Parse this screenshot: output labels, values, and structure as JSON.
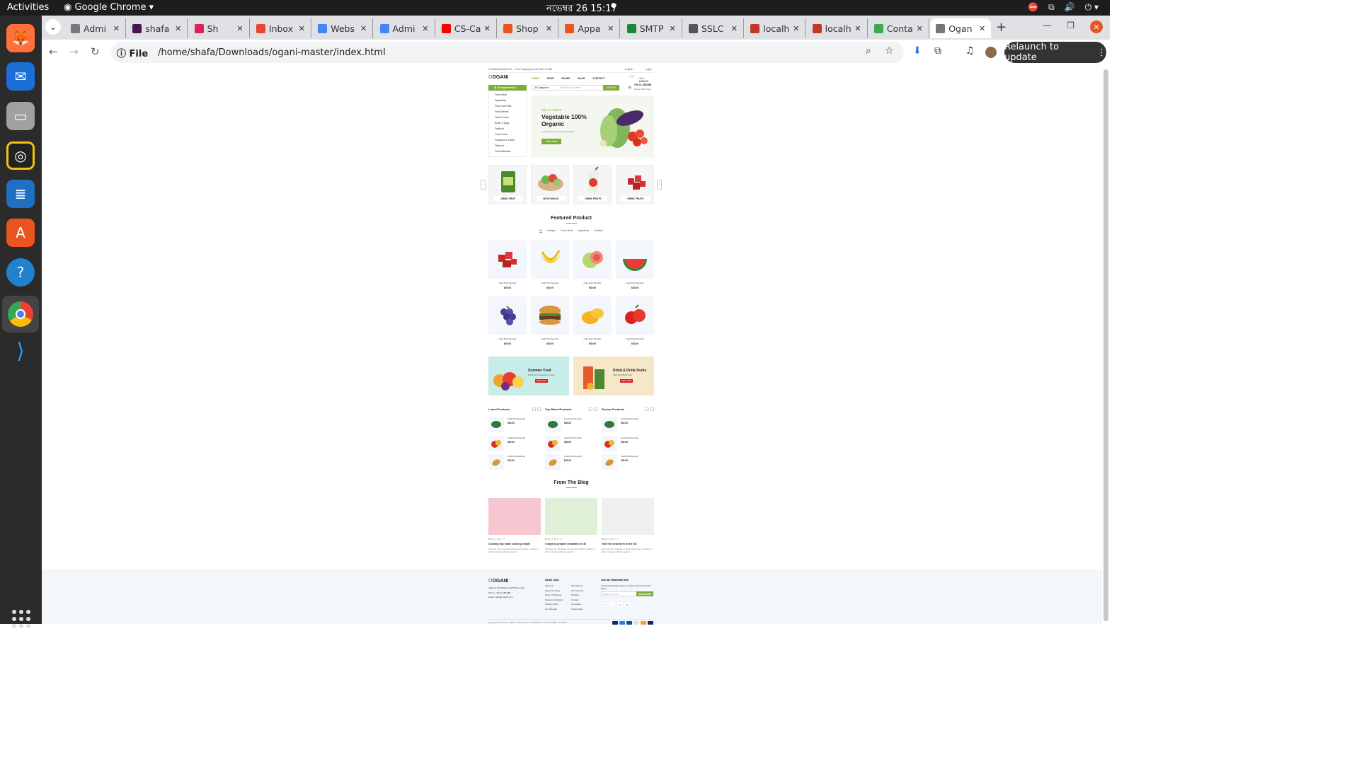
{
  "os": {
    "activities": "Activities",
    "app_menu": "Google Chrome",
    "clock": "নভেম্বর 26  15:17"
  },
  "dock": [
    "Firefox",
    "Thunderbird",
    "Files",
    "Rhythmbox",
    "LibreOffice Writer",
    "Ubuntu Software",
    "Help",
    "Google Chrome",
    "Visual Studio Code"
  ],
  "browser": {
    "tabs": [
      {
        "label": "Admi",
        "color": "#777777"
      },
      {
        "label": "shafa",
        "color": "#4a154b"
      },
      {
        "label": "Sh",
        "color": "#e01e5a"
      },
      {
        "label": "Inbox",
        "color": "#ea4335"
      },
      {
        "label": "Webs",
        "color": "#4285f4"
      },
      {
        "label": "Admi",
        "color": "#4285f4"
      },
      {
        "label": "CS-Ca",
        "color": "#ff0000"
      },
      {
        "label": "Shop",
        "color": "#e95420"
      },
      {
        "label": "Appa",
        "color": "#e95420"
      },
      {
        "label": "SMTP",
        "color": "#1a8a3a"
      },
      {
        "label": "SSLC",
        "color": "#555555"
      },
      {
        "label": "localh",
        "color": "#c0392b"
      },
      {
        "label": "localh",
        "color": "#c0392b"
      },
      {
        "label": "Conta",
        "color": "#3fa94f"
      },
      {
        "label": "Ogan",
        "color": "#777777"
      }
    ],
    "url_prefix": "File",
    "url": "/home/shafa/Downloads/ogani-master/index.html",
    "relaunch": "Relaunch to update"
  },
  "site": {
    "header_email": "hello@colorlib.com",
    "header_shipping": "Free Shipping for all Order of $99",
    "language": "English",
    "login": "Login",
    "logo": "OGANI",
    "nav": [
      "HOME",
      "SHOP",
      "PAGES",
      "BLOG",
      "CONTACT"
    ],
    "cart_item": "item:",
    "cart_total": "$150.00",
    "departments": "All departments",
    "departments_list": [
      "Fresh Meat",
      "Vegetables",
      "Fruit & Nut Gifts",
      "Fresh Berries",
      "Ocean Foods",
      "Butter & Eggs",
      "Fastfood",
      "Fresh Onion",
      "Papayaya & Crisps",
      "Oatmeal",
      "Fresh Bananas"
    ],
    "search_category": "All Categories",
    "search_placeholder": "What do you need?",
    "search_button": "SEARCH",
    "phone": "+65 11.188.888",
    "support": "support 24/7 time",
    "hero_label": "FRUIT FRESH",
    "hero_title": "Vegetable 100% Organic",
    "hero_sub": "Free Pickup and Delivery Available",
    "hero_button": "SHOP NOW",
    "categories": [
      "DRIED FRUIT",
      "VEGETABLES",
      "DRINK FRUITS",
      "DRINK FRUITS"
    ],
    "featured_title": "Featured Product",
    "filters": [
      "All",
      "Oranges",
      "Fresh Meat",
      "Vegetables",
      "Fastfood"
    ],
    "products": [
      {
        "name": "Crab Pool Security",
        "price": "$30.00",
        "icon": "meat"
      },
      {
        "name": "Crab Pool Security",
        "price": "$30.00",
        "icon": "banana"
      },
      {
        "name": "Crab Pool Security",
        "price": "$30.00",
        "icon": "guava"
      },
      {
        "name": "Crab Pool Security",
        "price": "$30.00",
        "icon": "watermelon"
      },
      {
        "name": "Crab Pool Security",
        "price": "$30.00",
        "icon": "grapes"
      },
      {
        "name": "Crab Pool Security",
        "price": "$30.00",
        "icon": "burger"
      },
      {
        "name": "Crab Pool Security",
        "price": "$30.00",
        "icon": "mango"
      },
      {
        "name": "Crab Pool Security",
        "price": "$30.00",
        "icon": "apple"
      }
    ],
    "banners": [
      {
        "title": "Summer Fruit",
        "sub": "100% Pure Natural Fruit Juice",
        "button": "SHOP NOW",
        "bg": "#c8ece8"
      },
      {
        "title": "Dried & Drink Fruits",
        "sub": "With 25% Off All Teas",
        "button": "SHOP NOW",
        "bg": "#f6e7c8"
      }
    ],
    "list_sections": [
      {
        "title": "Latest Products",
        "items": [
          {
            "name": "Crab Pool Security",
            "price": "$30.00"
          },
          {
            "name": "Crab Pool Security",
            "price": "$30.00"
          },
          {
            "name": "Crab Pool Security",
            "price": "$30.00"
          }
        ]
      },
      {
        "title": "Top Rated Products",
        "items": [
          {
            "name": "Crab Pool Security",
            "price": "$30.00"
          },
          {
            "name": "Crab Pool Security",
            "price": "$30.00"
          },
          {
            "name": "Crab Pool Security",
            "price": "$30.00"
          }
        ]
      },
      {
        "title": "Review Products",
        "items": [
          {
            "name": "Crab Pool Security",
            "price": "$30.00"
          },
          {
            "name": "Crab Pool Security",
            "price": "$30.00"
          },
          {
            "name": "Crab Pool Security",
            "price": "$30.00"
          }
        ]
      }
    ],
    "blog_title": "From The Blog",
    "blog": [
      {
        "date": "May 4,2019",
        "comments": "5",
        "title": "Cooking tips make cooking simple",
        "excerpt": "Sed quia non numquam modi tempora indunt ut labore et dolore magnam aliquam quaerat",
        "color": "#f6c6d1"
      },
      {
        "date": "May 4,2019",
        "comments": "5",
        "title": "6 ways to prepare breakfast for 30",
        "excerpt": "Sed quia non numquam modi tempora indunt ut labore et dolore magnam aliquam quaerat",
        "color": "#dff0d8"
      },
      {
        "date": "May 4,2019",
        "comments": "5",
        "title": "Visit the clean farm in the US",
        "excerpt": "Sed quia non numquam modi tempora indunt ut labore et dolore magnam aliquam quaerat",
        "color": "#eef0ee"
      }
    ],
    "footer": {
      "logo": "OGANI",
      "address": "Address: 60-49 Road 11378 New York",
      "phone": "Phone: +65 11.188.888",
      "email": "Email: hello@colorlib.com",
      "useful_title": "Useful Links",
      "links_a": [
        "About Us",
        "About Our Shop",
        "Secure Shopping",
        "Delivery infomation",
        "Privacy Policy",
        "Our Sitemap"
      ],
      "links_b": [
        "Who We Are",
        "Our Services",
        "Projects",
        "Contact",
        "Innovation",
        "Testimonials"
      ],
      "newsletter_title": "Join Our Newsletter Now",
      "newsletter_text": "Get E-mail updates about our latest shop and special offers.",
      "newsletter_placeholder": "Enter your mail",
      "newsletter_button": "SUBSCRIBE",
      "social": [
        "f",
        "i",
        "t",
        "p"
      ],
      "copyright": "Copyright ©2024 All rights reserved | This template is made with ♥ by Colorlib"
    }
  }
}
